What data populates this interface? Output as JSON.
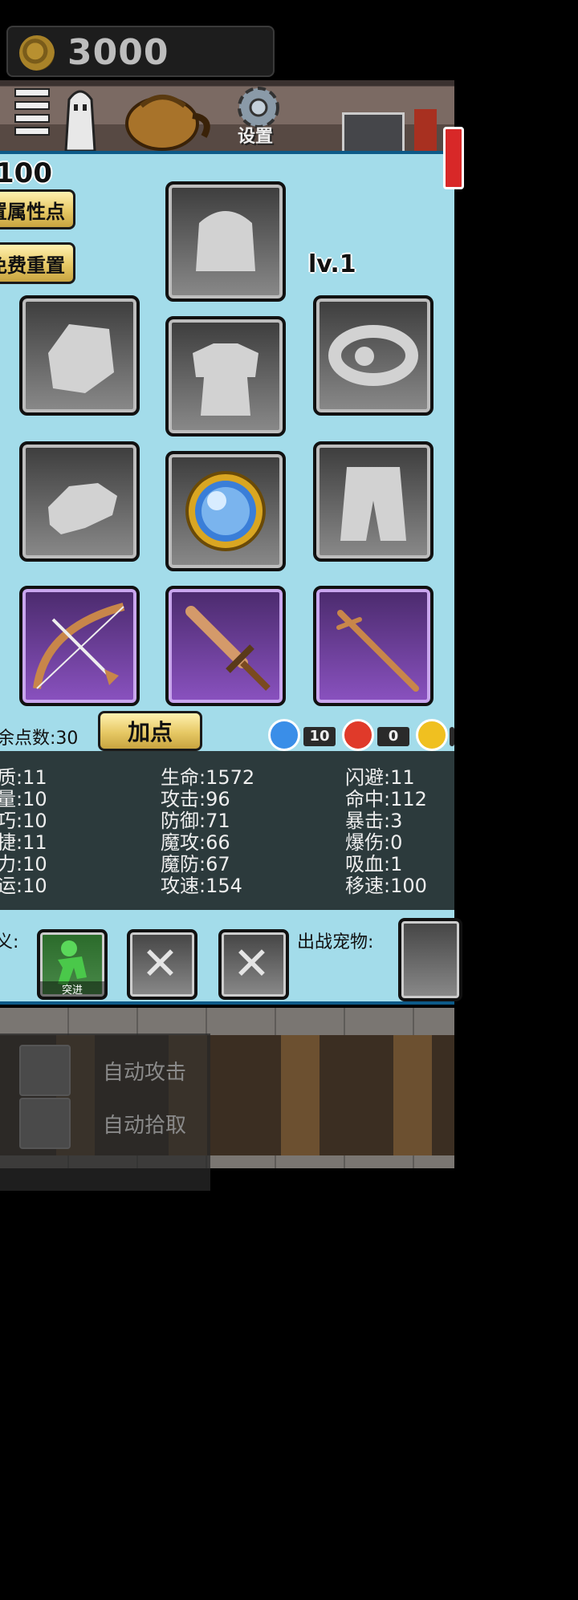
{
  "coins": "3000",
  "nav": {
    "settings_label": "设置"
  },
  "character": {
    "level_top": "100",
    "equip_level": "lv.1",
    "reset_attr_label": "置属性点",
    "free_reset_label": "免费重置",
    "remaining_points": "余点数:30",
    "add_points_label": "加点"
  },
  "equipment": [
    {
      "slot": "helmet",
      "icon": "helmet-placeholder-icon"
    },
    {
      "slot": "shoulder",
      "icon": "shoulder-placeholder-icon"
    },
    {
      "slot": "armor",
      "icon": "armor-placeholder-icon"
    },
    {
      "slot": "necklace",
      "icon": "necklace-placeholder-icon"
    },
    {
      "slot": "gloves",
      "icon": "gloves-placeholder-icon"
    },
    {
      "slot": "orb",
      "icon": "blue-orb-icon"
    },
    {
      "slot": "pants",
      "icon": "pants-placeholder-icon"
    },
    {
      "slot": "bow",
      "icon": "wooden-bow-icon"
    },
    {
      "slot": "sword",
      "icon": "wooden-sword-icon"
    },
    {
      "slot": "staff",
      "icon": "wooden-staff-icon"
    }
  ],
  "elements": [
    {
      "name": "water",
      "value": "10",
      "color": "#3a8ee8"
    },
    {
      "name": "fire",
      "value": "0",
      "color": "#e03a2a"
    },
    {
      "name": "lightning",
      "value": "",
      "color": "#f0c020"
    }
  ],
  "stats": {
    "col1": [
      "质:11",
      "量:10",
      "巧:10",
      "捷:11",
      "力:10",
      "运:10"
    ],
    "col2": [
      "生命:1572",
      "攻击:96",
      "防御:71",
      "魔攻:66",
      "魔防:67",
      "攻速:154"
    ],
    "col3": [
      "闪避:11",
      "命中:112",
      "暴击:3",
      "爆伤:0",
      "吸血:1",
      "移速:100"
    ]
  },
  "skills": {
    "label": "义:",
    "first_skill_badge": "突进",
    "pet_label": "出战宠物:"
  },
  "toggles": {
    "auto_attack": "自动攻击",
    "auto_pickup": "自动拾取"
  }
}
